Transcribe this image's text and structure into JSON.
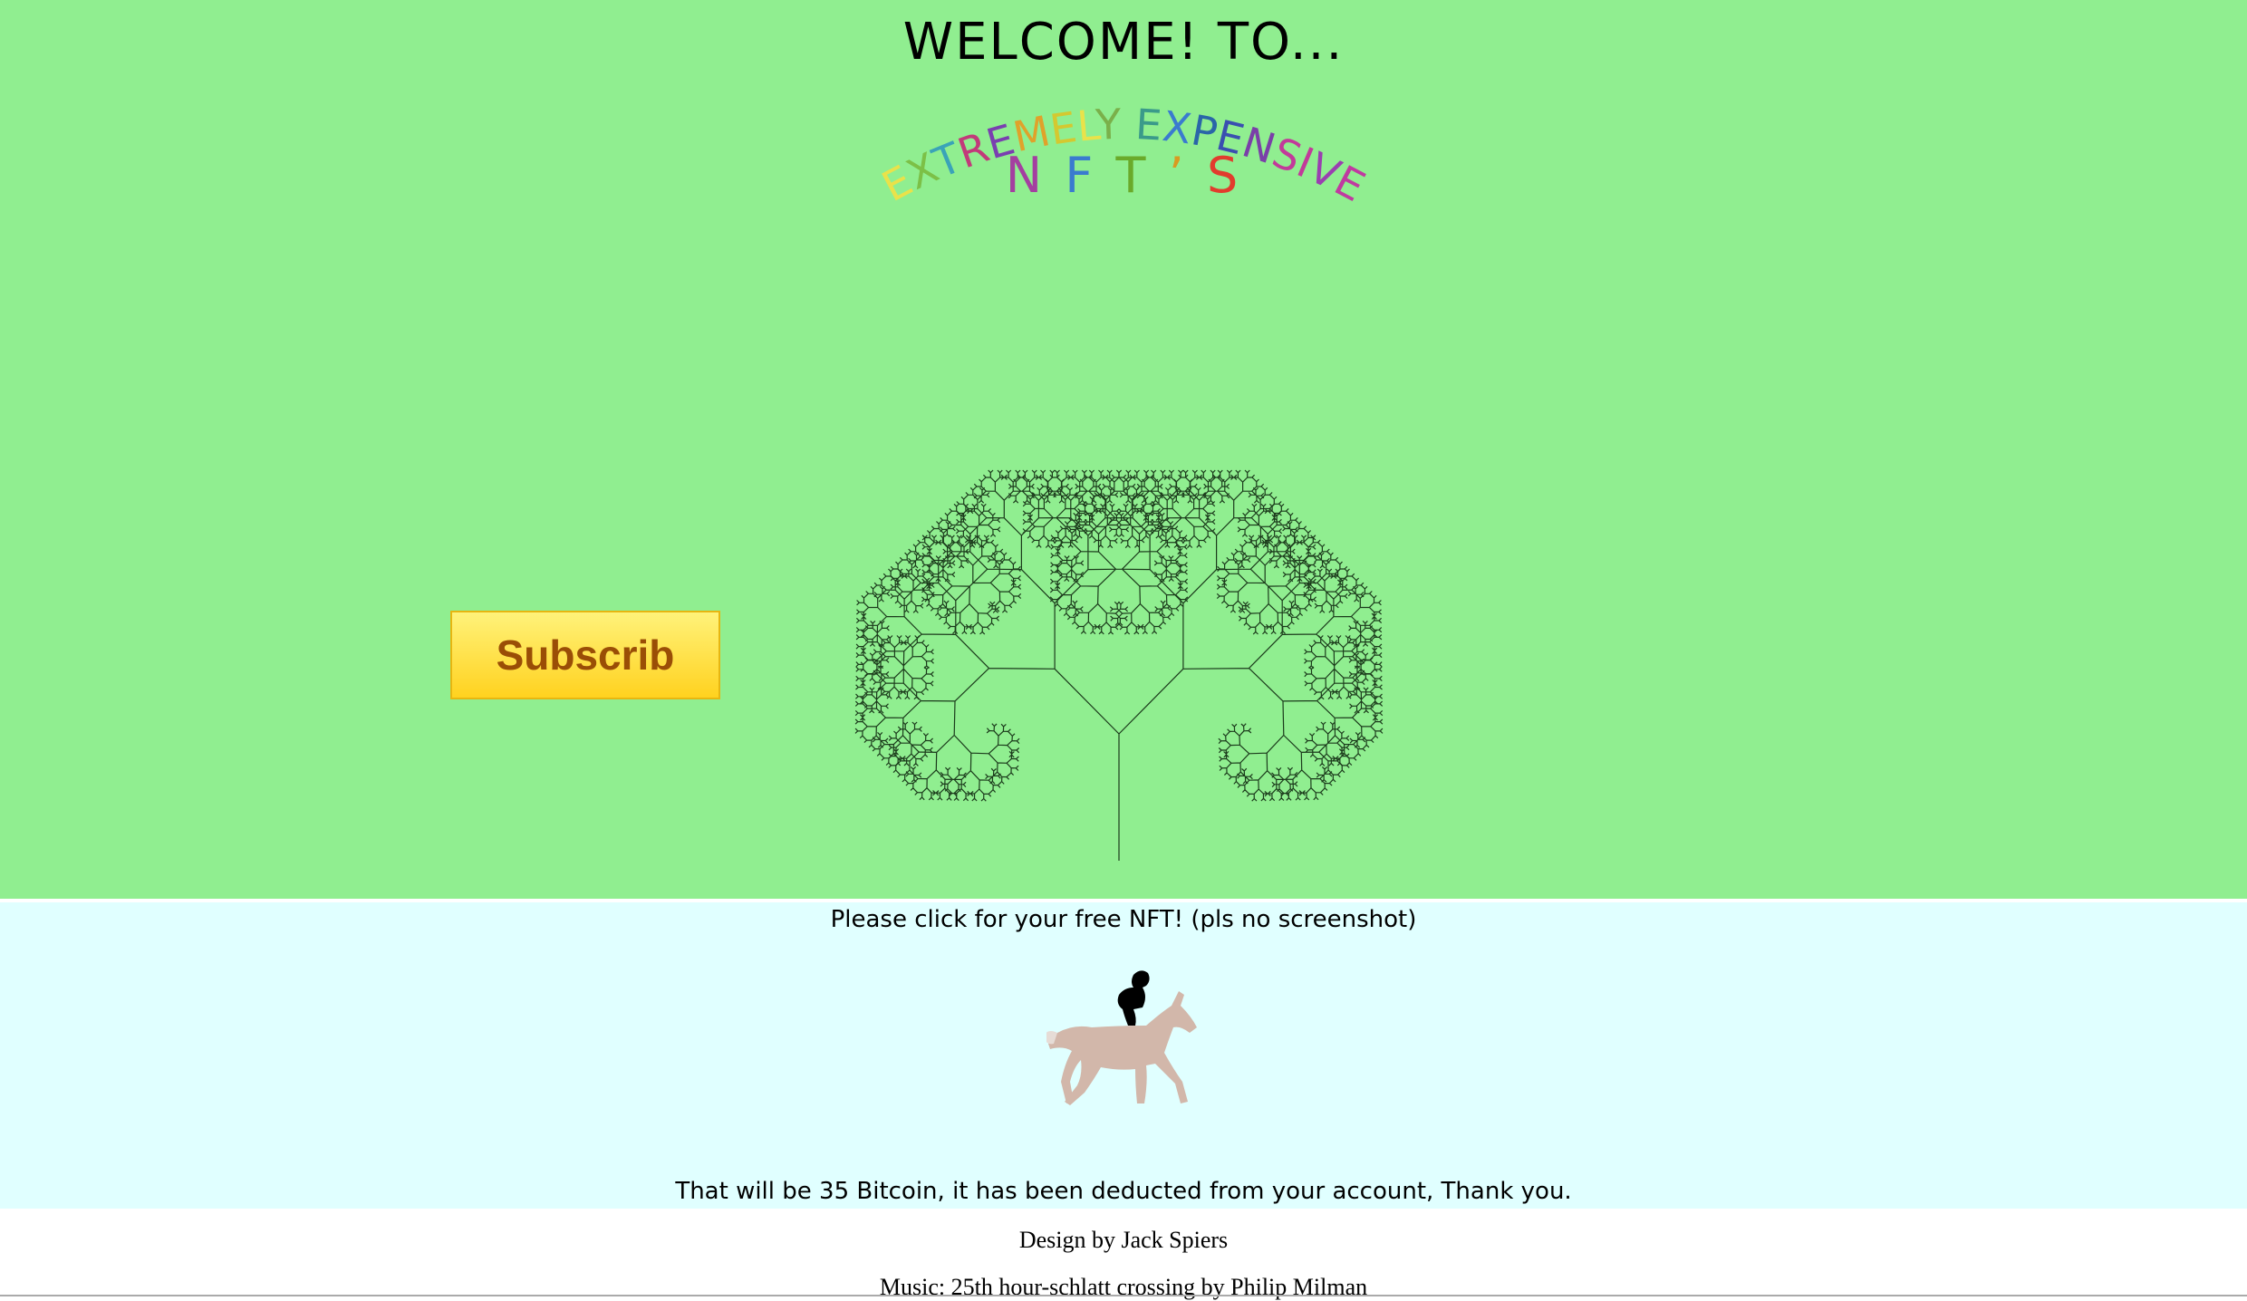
{
  "hero": {
    "welcome": "WELCOME! TO...",
    "arc_text": "EXTREMELY EXPENSIVE",
    "nft_letters": [
      "N",
      "F",
      "T",
      "’",
      "S"
    ],
    "subscribe_label": "Subscrib",
    "colors": {
      "background": "#90ee90",
      "button_text": "#9a4e06",
      "button_top": "#fff27a",
      "button_bottom": "#ffd21f"
    }
  },
  "panel": {
    "free_text": "Please click for your free NFT! (pls no screenshot)",
    "price_text": "That will be 35 Bitcoin, it has been deducted from your account, Thank you.",
    "image_icon": "horse-rider-icon",
    "background": "#e0ffff"
  },
  "footer": {
    "design_credit": "Design by Jack Spiers",
    "music_credit": "Music: 25th hour-schlatt crossing by Philip Milman"
  }
}
